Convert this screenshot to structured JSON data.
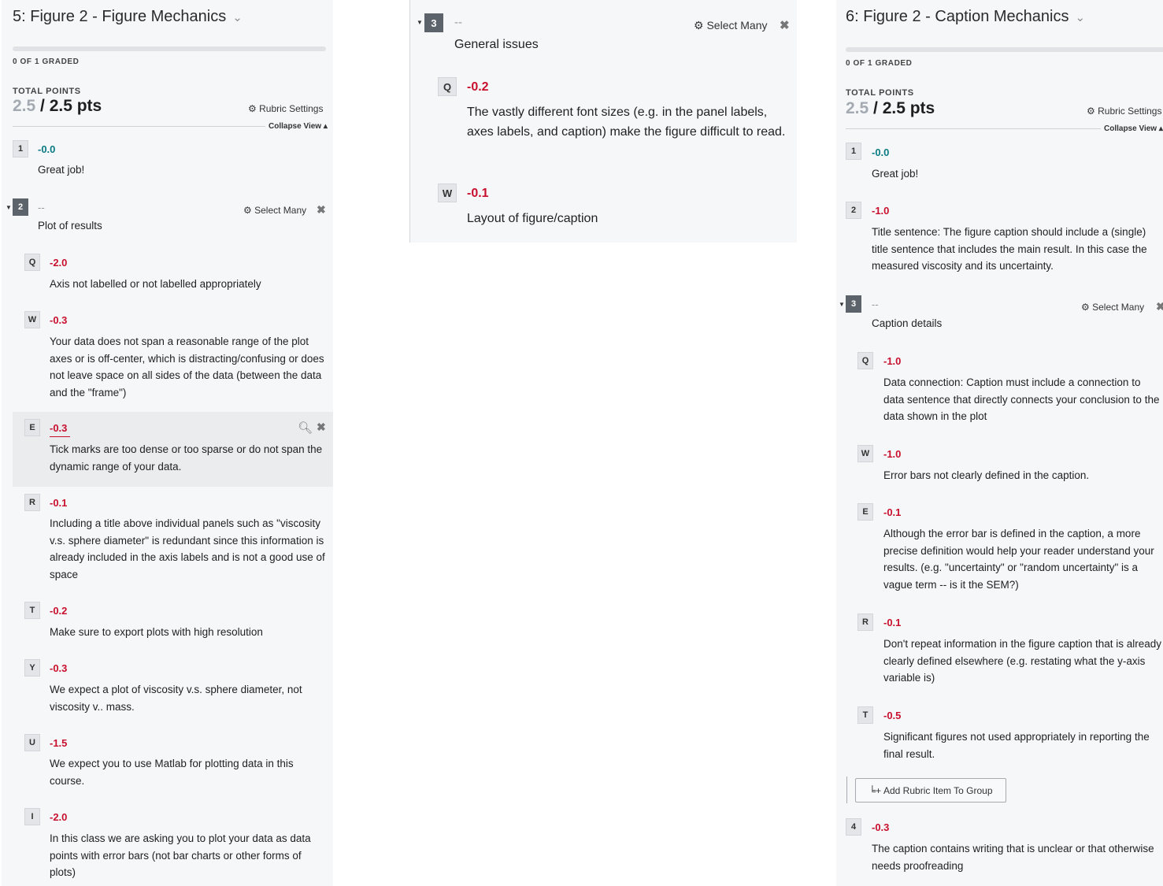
{
  "left": {
    "title": "5: Figure 2 - Figure Mechanics",
    "chevron": "⌄",
    "graded": "0 OF 1 GRADED",
    "total_label": "TOTAL POINTS",
    "score_current": "2.5",
    "score_max": " / 2.5 pts",
    "rubric_settings": "Rubric Settings",
    "collapse_view": "Collapse View ▴",
    "item1": {
      "key": "1",
      "pts": "-0.0",
      "text": "Great job!"
    },
    "group2": {
      "key": "2",
      "dash": "--",
      "label": "Plot of results",
      "select_many": "Select Many"
    },
    "sub": [
      {
        "key": "Q",
        "pts": "-2.0",
        "text": "Axis not labelled or not labelled appropriately"
      },
      {
        "key": "W",
        "pts": "-0.3",
        "text": "Your data does not span a reasonable range of the plot axes or is off-center, which is distracting/confusing or does not leave space on all sides of the data (between the data and the \"frame\")"
      },
      {
        "key": "E",
        "pts": "-0.3",
        "text": "Tick marks are too dense or too sparse or do not span the dynamic range of your data."
      },
      {
        "key": "R",
        "pts": "-0.1",
        "text": "Including a title above individual panels such as \"viscosity v.s. sphere diameter\" is redundant since this information is already included in the axis labels and is not a good use of space"
      },
      {
        "key": "T",
        "pts": "-0.2",
        "text": "Make sure to export plots with high resolution"
      },
      {
        "key": "Y",
        "pts": "-0.3",
        "text": "We expect a plot of viscosity v.s. sphere diameter, not viscosity v.. mass."
      },
      {
        "key": "U",
        "pts": "-1.5",
        "text": "We expect you to use Matlab for plotting data in this course."
      },
      {
        "key": "I",
        "pts": "-2.0",
        "text": "In this class we are asking you to plot your data as data points with error bars (not bar charts or other forms of plots)"
      }
    ]
  },
  "mid": {
    "group3": {
      "key": "3",
      "dash": "--",
      "label": "General issues",
      "select_many": "Select Many"
    },
    "sub": [
      {
        "key": "Q",
        "pts": "-0.2",
        "text": "The vastly different font sizes (e.g. in the panel labels, axes labels, and caption) make the figure difficult to read."
      },
      {
        "key": "W",
        "pts": "-0.1",
        "text": "Layout of figure/caption"
      }
    ]
  },
  "right": {
    "title": "6: Figure 2 - Caption Mechanics",
    "chevron": "⌄",
    "graded": "0 OF 1 GRADED",
    "total_label": "TOTAL POINTS",
    "score_current": "2.5",
    "score_max": " / 2.5 pts",
    "rubric_settings": "Rubric Settings",
    "collapse_view": "Collapse View ▴",
    "item1": {
      "key": "1",
      "pts": "-0.0",
      "text": "Great job!"
    },
    "item2": {
      "key": "2",
      "pts": "-1.0",
      "text": "Title sentence: The figure caption should include a (single) title sentence that includes the main result. In this case the measured viscosity and its uncertainty."
    },
    "group3": {
      "key": "3",
      "dash": "--",
      "label": "Caption details",
      "select_many": "Select Many"
    },
    "sub": [
      {
        "key": "Q",
        "pts": "-1.0",
        "text": "Data connection: Caption must include a connection to data sentence that directly connects your conclusion to the data shown in the plot"
      },
      {
        "key": "W",
        "pts": "-1.0",
        "text": "Error bars not clearly defined in the caption."
      },
      {
        "key": "E",
        "pts": "-0.1",
        "text": "Although the error bar is defined in the caption, a more precise definition would help your reader understand your results.  (e.g. \"uncertainty\" or \"random uncertainty\" is a vague term -- is it the SEM?)"
      },
      {
        "key": "R",
        "pts": "-0.1",
        "text": "Don't repeat information in the figure caption that is already clearly defined elsewhere (e.g. restating what the y-axis variable is)"
      },
      {
        "key": "T",
        "pts": "-0.5",
        "text": "Significant figures not used appropriately in reporting the final result."
      }
    ],
    "add_item": "Add Rubric Item To Group",
    "item4": {
      "key": "4",
      "pts": "-0.3",
      "text": "The caption contains writing that is unclear or that otherwise needs proofreading"
    }
  }
}
